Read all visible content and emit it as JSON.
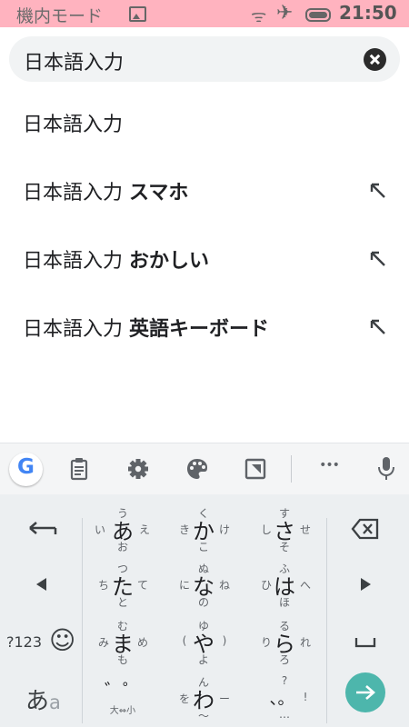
{
  "status_bar": {
    "mode_label": "機内モード",
    "time": "21:50"
  },
  "search": {
    "query": "日本語入力"
  },
  "suggestions": [
    {
      "prefix": "日本語入力",
      "suffix": ""
    },
    {
      "prefix": "日本語入力",
      "suffix": "スマホ"
    },
    {
      "prefix": "日本語入力",
      "suffix": "おかしい"
    },
    {
      "prefix": "日本語入力",
      "suffix": "英語キーボード"
    }
  ],
  "keyboard": {
    "toolbar_icons": [
      "google-icon",
      "clipboard-icon",
      "settings-icon",
      "theme-palette-icon",
      "one-hand-mode-icon",
      "more-icon",
      "microphone-icon"
    ],
    "google_letter": "G",
    "more_label": "•••",
    "numbers_key": "?123",
    "emoji_key": "☺",
    "lang_key_main": "あ",
    "lang_key_sub": "a",
    "rows": [
      [
        {
          "main": "あ",
          "up": "う",
          "left": "い",
          "right": "え",
          "down": "お"
        },
        {
          "main": "か",
          "up": "く",
          "left": "き",
          "right": "け",
          "down": "こ"
        },
        {
          "main": "さ",
          "up": "す",
          "left": "し",
          "right": "せ",
          "down": "そ"
        }
      ],
      [
        {
          "main": "た",
          "up": "つ",
          "left": "ち",
          "right": "て",
          "down": "と"
        },
        {
          "main": "な",
          "up": "ぬ",
          "left": "に",
          "right": "ね",
          "down": "の"
        },
        {
          "main": "は",
          "up": "ふ",
          "left": "ひ",
          "right": "へ",
          "down": "ほ"
        }
      ],
      [
        {
          "main": "ま",
          "up": "む",
          "left": "み",
          "right": "め",
          "down": "も"
        },
        {
          "main": "や",
          "up": "ゆ",
          "left": "(",
          "right": ")",
          "down": "よ"
        },
        {
          "main": "ら",
          "up": "る",
          "left": "り",
          "right": "れ",
          "down": "ろ"
        }
      ],
      [
        {
          "main": "゛゜",
          "up": "",
          "left": "",
          "right": "",
          "down": "大⇔小"
        },
        {
          "main": "わ",
          "up": "ん",
          "left": "を",
          "right": "ー",
          "down": "〜"
        },
        {
          "main": "、。",
          "up": "?",
          "left": "",
          "right": "!",
          "down": "…"
        }
      ]
    ]
  }
}
